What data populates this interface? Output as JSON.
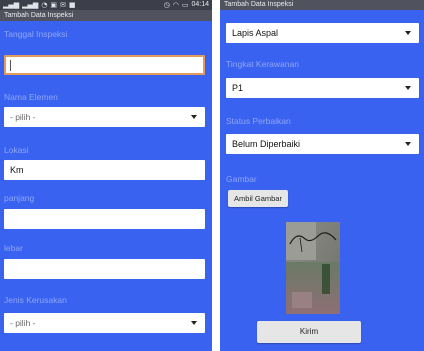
{
  "left_screen": {
    "status_bar": {
      "time": "04:14",
      "left_icons": [
        "signal-icon",
        "signal-icon",
        "wifi-icon",
        "image-icon",
        "message-icon",
        "notification-icon"
      ],
      "right_icons": [
        "alarm-icon",
        "wifi-icon",
        "battery-icon"
      ]
    },
    "title": "Tambah Data Inspeksi",
    "fields": [
      {
        "label": "Tanggal Inspeksi",
        "value": ""
      },
      {
        "label": "Nama Elemen",
        "value": "- pilih -"
      },
      {
        "label": "Lokasi",
        "value": "Km"
      },
      {
        "label": "panjang",
        "value": ""
      },
      {
        "label": "lebar",
        "value": ""
      },
      {
        "label": "Jenis Kerusakan",
        "value": "- pilih -"
      }
    ]
  },
  "right_screen": {
    "title": "Tambah Data Inspeksi",
    "fields": [
      {
        "label": "",
        "value": "Lapis Aspal"
      },
      {
        "label": "Tingkat Kerawanan",
        "value": "P1"
      },
      {
        "label": "Status Perbaikan",
        "value": "Belum Diperbaiki"
      }
    ],
    "gambar_label": "Gambar",
    "ambil_gambar_button": "Ambil Gambar",
    "kirim_button": "Kirim"
  },
  "colors": {
    "background": "#3a62f0",
    "label": "#8ea6f8",
    "title_bar": "#50535e",
    "status_bar": "#3c3f4a",
    "focus_border": "#e29a5d"
  }
}
